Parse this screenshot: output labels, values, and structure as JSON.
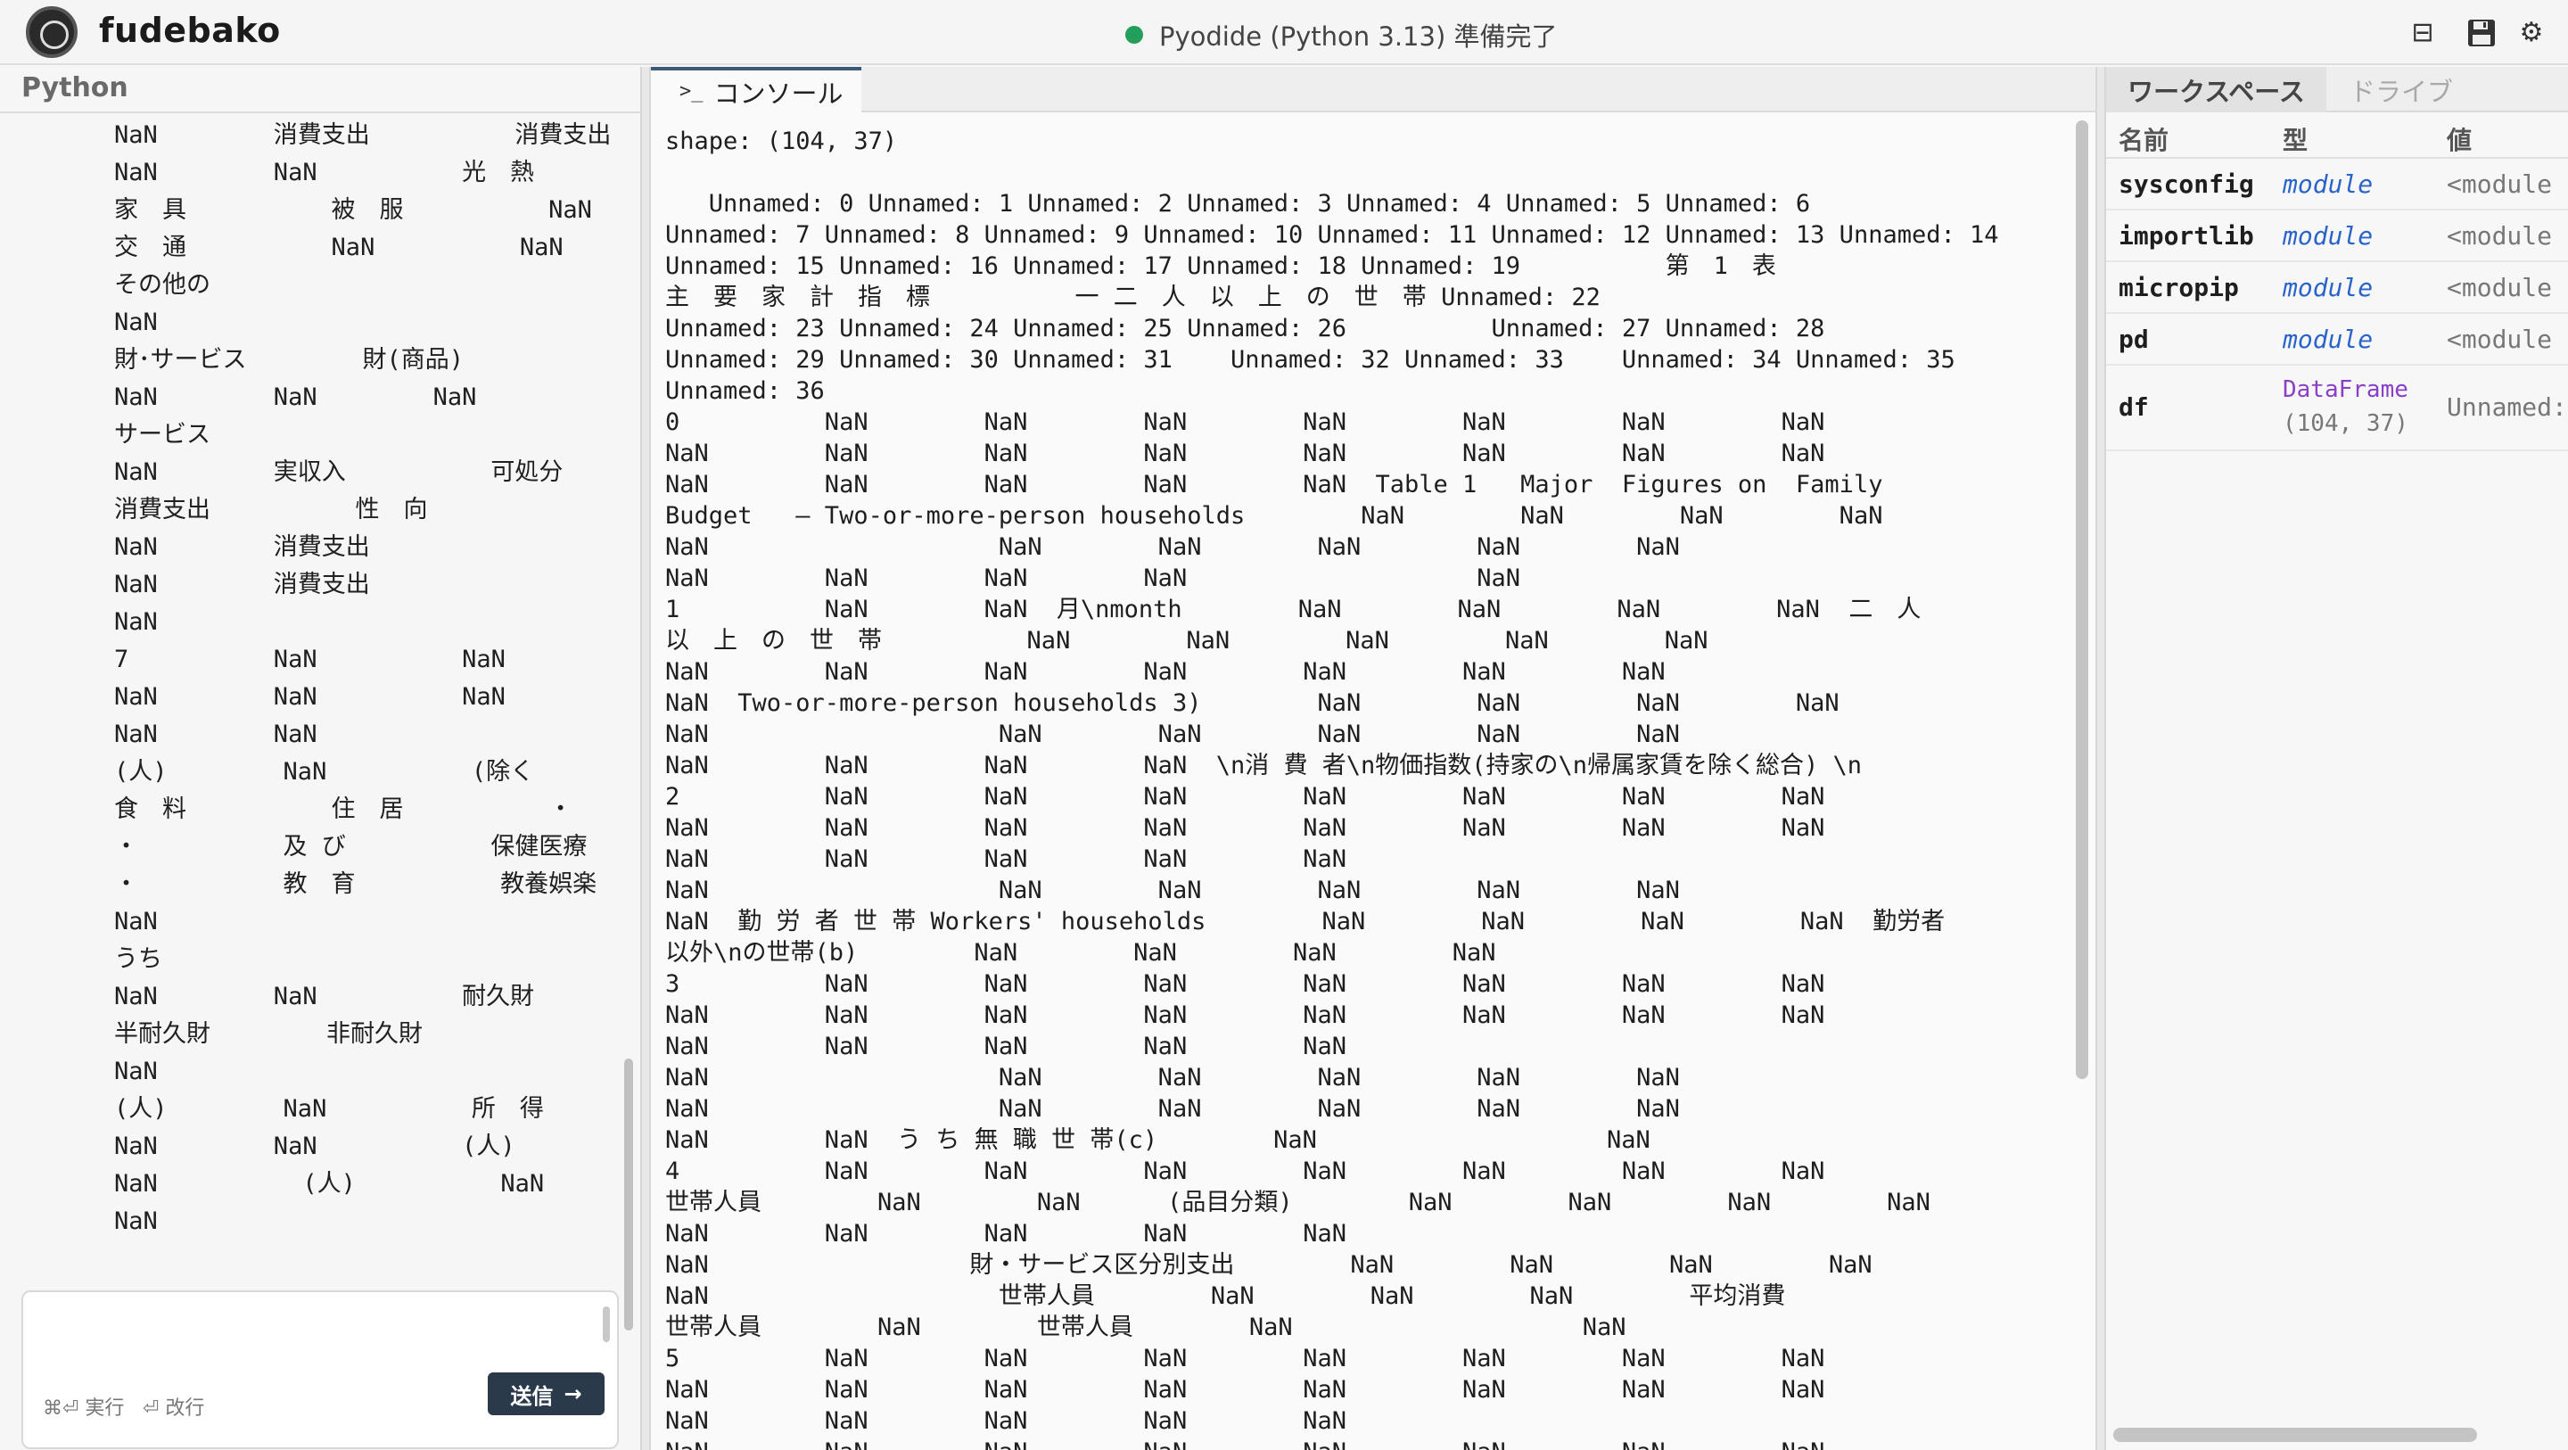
{
  "header": {
    "app_title": "fudebako",
    "status_text": "Pyodide (Python 3.13) 準備完了",
    "status_color": "#22a05b",
    "icons": [
      "layout-icon",
      "save-icon",
      "settings-icon"
    ]
  },
  "left_panel": {
    "title": "Python",
    "output_text": "NaN        消費支出          消費支出\nNaN        NaN          光　熱\n家　具          被　服          NaN\n交　通          NaN          NaN\nその他の\nNaN\n財･サービス        財(商品)\nNaN        NaN        NaN\nサービス\nNaN        実収入          可処分\n消費支出          性　向\nNaN        消費支出\nNaN        消費支出\nNaN\n7          NaN          NaN\nNaN        NaN          NaN\nNaN        NaN\n(人)        NaN          (除く\n食　料          住　居          ・\n・          及 び          保健医療\n・          教　育          教養娯楽\nNaN\nうち\nNaN        NaN          耐久財\n半耐久財        非耐久財\nNaN\n(人)        NaN          所　得\nNaN        NaN          (人)\nNaN          (人)          NaN\nNaN",
    "input": {
      "value": "",
      "hint_run": "⌘⏎ 実行",
      "hint_newline": "⏎ 改行",
      "send_label": "送信",
      "send_arrow": "→"
    }
  },
  "console": {
    "tab_icon": ">_",
    "tab_label": "コンソール",
    "output_text": "shape: (104, 37)\n\n   Unnamed: 0 Unnamed: 1 Unnamed: 2 Unnamed: 3 Unnamed: 4 Unnamed: 5 Unnamed: 6\nUnnamed: 7 Unnamed: 8 Unnamed: 9 Unnamed: 10 Unnamed: 11 Unnamed: 12 Unnamed: 13 Unnamed: 14\nUnnamed: 15 Unnamed: 16 Unnamed: 17 Unnamed: 18 Unnamed: 19          第　1　表\n主　要　家　計　指　標          一 二　人　以　上　の　世　帯 Unnamed: 22\nUnnamed: 23 Unnamed: 24 Unnamed: 25 Unnamed: 26          Unnamed: 27 Unnamed: 28\nUnnamed: 29 Unnamed: 30 Unnamed: 31    Unnamed: 32 Unnamed: 33    Unnamed: 34 Unnamed: 35\nUnnamed: 36\n0          NaN        NaN        NaN        NaN        NaN        NaN        NaN\nNaN        NaN        NaN        NaN        NaN        NaN        NaN        NaN\nNaN        NaN        NaN        NaN        NaN  Table 1   Major  Figures on  Family\nBudget   — Two-or-more-person households        NaN        NaN        NaN        NaN\nNaN                    NaN        NaN        NaN        NaN        NaN\nNaN        NaN        NaN        NaN                    NaN\n1          NaN        NaN  月\\nmonth        NaN        NaN        NaN        NaN  二　人\n以　上　の　世　帯          NaN        NaN        NaN        NaN        NaN\nNaN        NaN        NaN        NaN        NaN        NaN        NaN\nNaN  Two-or-more-person households 3)        NaN        NaN        NaN        NaN\nNaN                    NaN        NaN        NaN        NaN        NaN\nNaN        NaN        NaN        NaN  \\n消 費 者\\n物価指数(持家の\\n帰属家賃を除く総合) \\n\n2          NaN        NaN        NaN        NaN        NaN        NaN        NaN\nNaN        NaN        NaN        NaN        NaN        NaN        NaN        NaN\nNaN        NaN        NaN        NaN        NaN\nNaN                    NaN        NaN        NaN        NaN        NaN\nNaN  勤 労 者 世 帯 Workers' households        NaN        NaN        NaN        NaN  勤労者\n以外\\nの世帯(b)        NaN        NaN        NaN        NaN\n3          NaN        NaN        NaN        NaN        NaN        NaN        NaN\nNaN        NaN        NaN        NaN        NaN        NaN        NaN        NaN\nNaN        NaN        NaN        NaN        NaN\nNaN                    NaN        NaN        NaN        NaN        NaN\nNaN                    NaN        NaN        NaN        NaN        NaN\nNaN        NaN  う ち 無 職 世 帯(c)        NaN                    NaN\n4          NaN        NaN        NaN        NaN        NaN        NaN        NaN\n世帯人員        NaN        NaN      (品目分類)        NaN        NaN        NaN        NaN\nNaN        NaN        NaN        NaN        NaN\nNaN                  財・サービス区分別支出        NaN        NaN        NaN        NaN\nNaN                    世帯人員        NaN        NaN        NaN        平均消費\n世帯人員        NaN        世帯人員        NaN                    NaN\n5          NaN        NaN        NaN        NaN        NaN        NaN        NaN\nNaN        NaN        NaN        NaN        NaN        NaN        NaN        NaN\nNaN        NaN        NaN        NaN        NaN\nNaN        NaN        NaN        NaN        NaN        NaN        NaN        NaN"
  },
  "workspace": {
    "tabs": [
      "ワークスペース",
      "ドライブ"
    ],
    "columns": [
      "名前",
      "型",
      "値"
    ],
    "rows": [
      {
        "name": "sysconfig",
        "type": "module",
        "value": "<module"
      },
      {
        "name": "importlib",
        "type": "module",
        "value": "<module"
      },
      {
        "name": "micropip",
        "type": "module",
        "value": "<module"
      },
      {
        "name": "pd",
        "type": "module",
        "value": "<module"
      }
    ],
    "df_row": {
      "name": "df",
      "type": "DataFrame",
      "shape": "(104, 37)",
      "value": "Unnamed:"
    }
  }
}
